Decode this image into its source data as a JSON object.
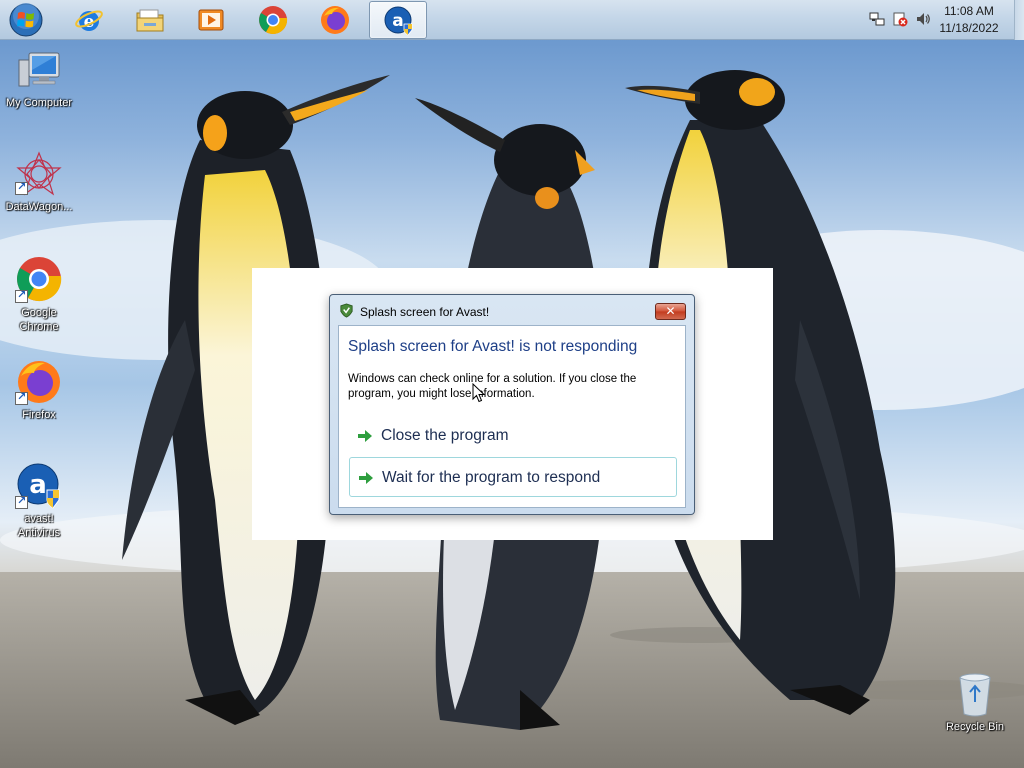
{
  "taskbar": {
    "buttons": [
      {
        "icon": "internet-explorer-icon"
      },
      {
        "icon": "file-explorer-icon"
      },
      {
        "icon": "media-player-icon"
      },
      {
        "icon": "chrome-icon"
      },
      {
        "icon": "firefox-icon"
      },
      {
        "icon": "avast-icon",
        "active": true
      }
    ],
    "tray": {
      "icons": [
        "network-icon",
        "action-center-icon",
        "volume-icon"
      ],
      "time": "11:08 AM",
      "date": "11/18/2022"
    }
  },
  "desktop_icons": [
    {
      "label": "My Computer",
      "icon": "computer-icon"
    },
    {
      "label": "DataWagon...",
      "icon": "datawagon-icon"
    },
    {
      "label": "Google Chrome",
      "icon": "chrome-icon"
    },
    {
      "label": "Firefox",
      "icon": "firefox-icon"
    },
    {
      "label": "avast! Antivirus",
      "icon": "avast-icon"
    },
    {
      "label": "Recycle Bin",
      "icon": "recycle-bin-icon"
    }
  ],
  "dialog": {
    "title": "Splash screen for Avast!",
    "main_instruction": "Splash screen for Avast! is not responding",
    "body": "Windows can check online for a solution. If you close the program, you might lose information.",
    "options": [
      {
        "label": "Close the program"
      },
      {
        "label": "Wait for the program to respond",
        "selected": true
      }
    ],
    "close_symbol": "✕"
  },
  "colors": {
    "instruction_text": "#1e3f87",
    "command_arrow": "#2e9e3e",
    "close_button": "#c94a2e"
  }
}
